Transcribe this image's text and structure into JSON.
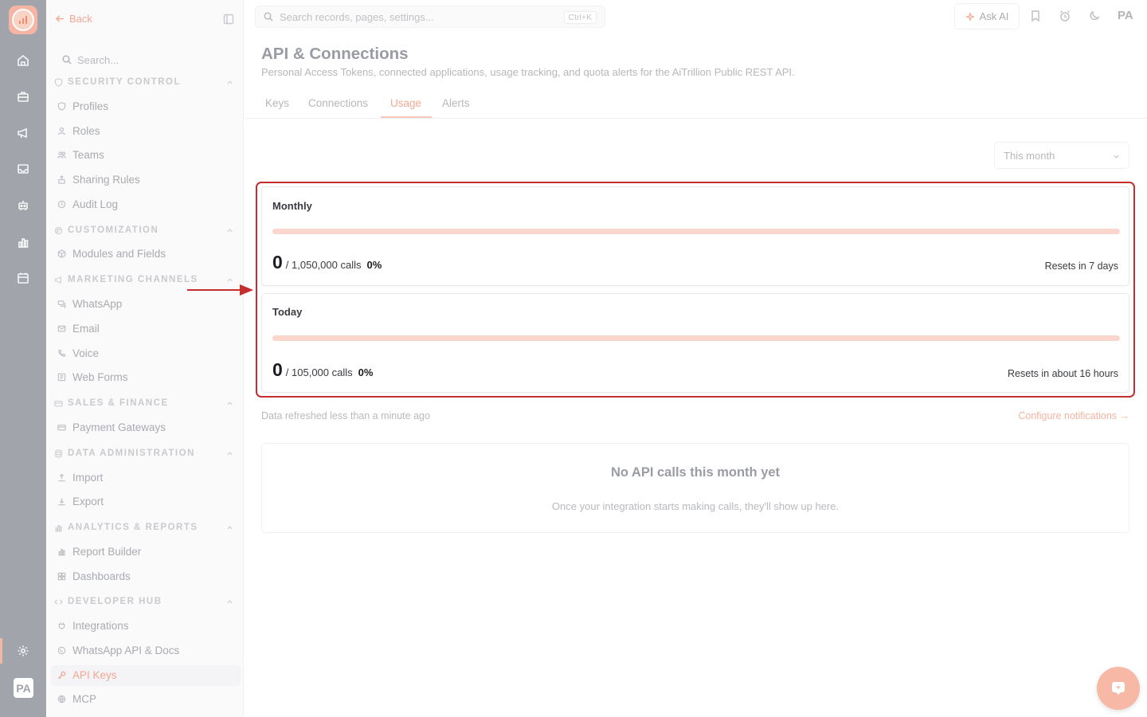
{
  "sidebar": {
    "back_label": "Back",
    "search_placeholder": "Search...",
    "sections": {
      "security": "SECURITY CONTROL",
      "customization": "CUSTOMIZATION",
      "marketing": "MARKETING CHANNELS",
      "sales": "SALES & FINANCE",
      "data_admin": "DATA ADMINISTRATION",
      "analytics": "ANALYTICS & REPORTS",
      "developer": "DEVELOPER HUB"
    },
    "items": {
      "profiles": "Profiles",
      "roles": "Roles",
      "teams": "Teams",
      "sharing_rules": "Sharing Rules",
      "audit_log": "Audit Log",
      "modules_fields": "Modules and Fields",
      "whatsapp": "WhatsApp",
      "email": "Email",
      "voice": "Voice",
      "web_forms": "Web Forms",
      "payment_gateways": "Payment Gateways",
      "import": "Import",
      "export": "Export",
      "report_builder": "Report Builder",
      "dashboards": "Dashboards",
      "integrations": "Integrations",
      "whatsapp_api_docs": "WhatsApp API & Docs",
      "api_keys": "API Keys",
      "mcp": "MCP"
    }
  },
  "rail": {
    "avatar": "PA"
  },
  "topbar": {
    "search_placeholder": "Search records, pages, settings...",
    "shortcut": "Ctrl+K",
    "ask_ai": "Ask AI",
    "avatar": "PA"
  },
  "page": {
    "title": "API & Connections",
    "subtitle": "Personal Access Tokens, connected applications, usage tracking, and quota alerts for the AiTrillion Public REST API.",
    "tabs": [
      "Keys",
      "Connections",
      "Usage",
      "Alerts"
    ],
    "period": "This month"
  },
  "usage": {
    "monthly": {
      "title": "Monthly",
      "value": "0",
      "limit": "/ 1,050,000 calls",
      "percent": "0%",
      "fill": 0,
      "resets": "Resets in 7 days"
    },
    "today": {
      "title": "Today",
      "value": "0",
      "limit": "/ 105,000 calls",
      "percent": "0%",
      "fill": 0,
      "resets": "Resets in about 16 hours"
    },
    "refreshed": "Data refreshed less than a minute ago",
    "configure": "Configure notifications →"
  },
  "empty_state": {
    "title": "No API calls this month yet",
    "subtitle": "Once your integration starts making calls, they'll show up here."
  },
  "colors": {
    "accent": "#f08b6e",
    "highlight": "#c62d2d"
  }
}
